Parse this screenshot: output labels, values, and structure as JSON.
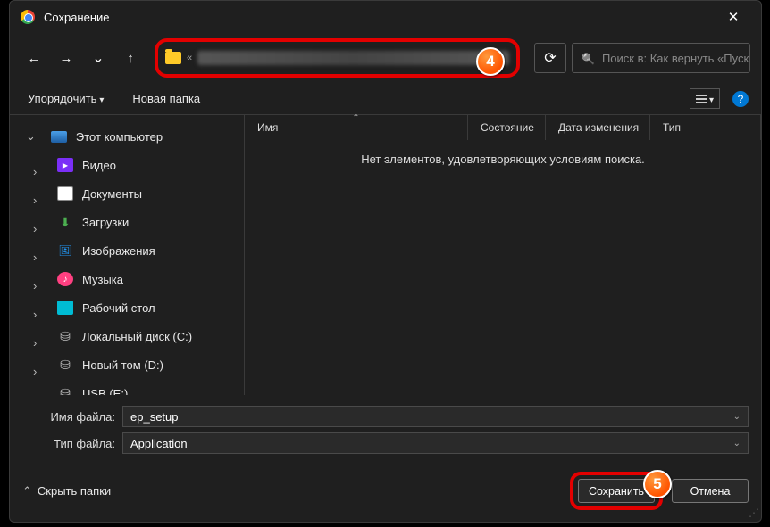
{
  "window": {
    "title": "Сохранение"
  },
  "search": {
    "placeholder": "Поиск в: Как вернуть «Пуск..."
  },
  "toolbar": {
    "organize": "Упорядочить",
    "newFolder": "Новая папка",
    "help": "?"
  },
  "sidebar": {
    "root": "Этот компьютер",
    "items": [
      {
        "label": "Видео",
        "icon": "video-ic"
      },
      {
        "label": "Документы",
        "icon": "docs-ic"
      },
      {
        "label": "Загрузки",
        "icon": "down-ic"
      },
      {
        "label": "Изображения",
        "icon": "pics-ic"
      },
      {
        "label": "Музыка",
        "icon": "music-ic"
      },
      {
        "label": "Рабочий стол",
        "icon": "desktop-ic"
      },
      {
        "label": "Локальный диск (C:)",
        "icon": "disk-ic"
      },
      {
        "label": "Новый том (D:)",
        "icon": "disk-ic"
      },
      {
        "label": "USB (E:)",
        "icon": "disk-ic"
      }
    ]
  },
  "columns": {
    "name": "Имя",
    "state": "Состояние",
    "modified": "Дата изменения",
    "type": "Тип"
  },
  "content": {
    "empty": "Нет элементов, удовлетворяющих условиям поиска."
  },
  "form": {
    "filenameLabel": "Имя файла:",
    "filenameValue": "ep_setup",
    "filetypeLabel": "Тип файла:",
    "filetypeValue": "Application"
  },
  "footer": {
    "hideFolders": "Скрыть папки",
    "save": "Сохранить",
    "cancel": "Отмена"
  },
  "badges": {
    "four": "4",
    "five": "5"
  }
}
